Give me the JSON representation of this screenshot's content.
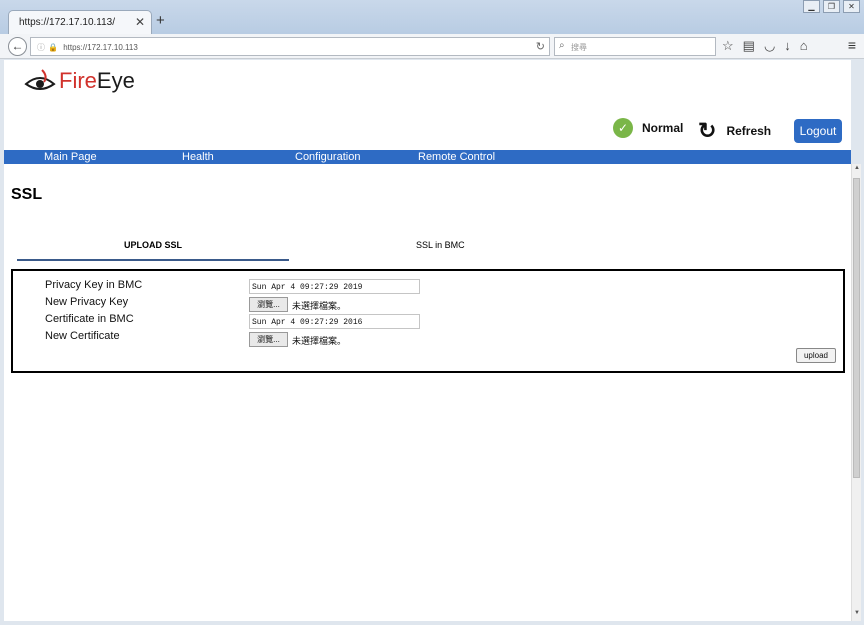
{
  "browser": {
    "tab_title": "https://172.17.10.113/",
    "url": "https://172.17.10.113",
    "search_placeholder": "搜尋"
  },
  "brand": {
    "logo_fire": "Fire",
    "logo_eye": "Eye"
  },
  "header": {
    "status_label": "Normal",
    "refresh_label": "Refresh",
    "logout_label": "Logout"
  },
  "nav": {
    "items": [
      "Main Page",
      "Health",
      "Configuration",
      "Remote Control"
    ]
  },
  "page": {
    "title": "SSL",
    "tabs": [
      "UPLOAD SSL",
      "SSL in BMC"
    ]
  },
  "form": {
    "privacy_key_label": "Privacy Key in BMC",
    "privacy_key_value": "Sun Apr  4 09:27:29 2019",
    "new_privacy_key_label": "New Privacy Key",
    "certificate_label": "Certificate in BMC",
    "certificate_value": "Sun Apr  4 09:27:29 2016",
    "new_certificate_label": "New Certificate",
    "browse_label": "瀏覽...",
    "no_file_label": "未選擇檔案。",
    "upload_label": "upload"
  },
  "colors": {
    "accent": "#2e6bc4",
    "brand_red": "#d1322c",
    "status_green": "#7ab648"
  }
}
